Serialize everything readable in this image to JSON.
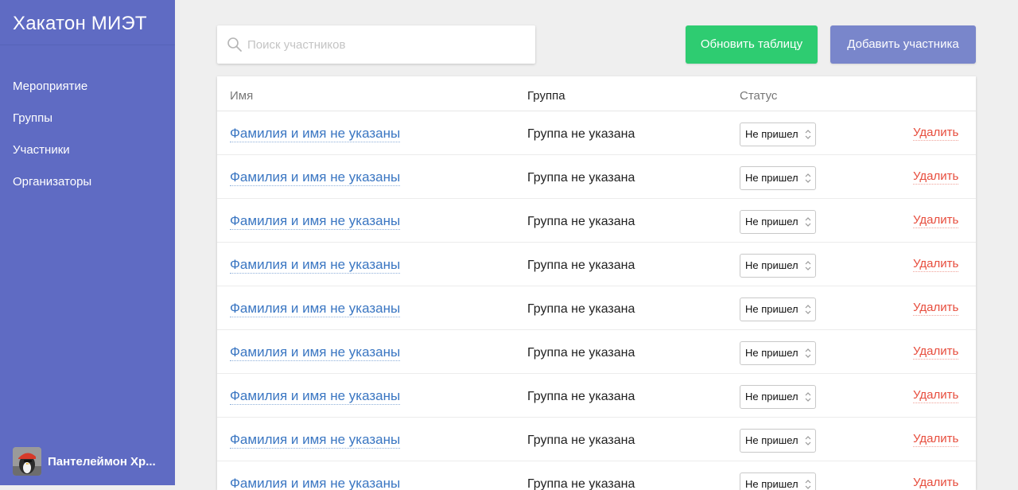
{
  "app": {
    "title": "Хакатон МИЭТ"
  },
  "sidebar": {
    "items": [
      {
        "label": "Мероприятие"
      },
      {
        "label": "Группы"
      },
      {
        "label": "Участники"
      },
      {
        "label": "Организаторы"
      }
    ],
    "user": {
      "name": "Пантелеймон Хр..."
    }
  },
  "search": {
    "placeholder": "Поиск участников",
    "value": ""
  },
  "toolbar": {
    "refresh_label": "Обновить таблицу",
    "add_label": "Добавить участника"
  },
  "colors": {
    "sidebar_bg": "#5f6bc3",
    "refresh_button": "#2ecc71",
    "add_button": "#7986cb",
    "link": "#3a76c2",
    "delete": "#e74c3c"
  },
  "table": {
    "columns": {
      "name": "Имя",
      "group": "Группа",
      "status": "Статус"
    },
    "rows": [
      {
        "name": "Фамилия и имя не указаны",
        "group": "Группа не указана",
        "status": "Не пришел",
        "action": "Удалить"
      },
      {
        "name": "Фамилия и имя не указаны",
        "group": "Группа не указана",
        "status": "Не пришел",
        "action": "Удалить"
      },
      {
        "name": "Фамилия и имя не указаны",
        "group": "Группа не указана",
        "status": "Не пришел",
        "action": "Удалить"
      },
      {
        "name": "Фамилия и имя не указаны",
        "group": "Группа не указана",
        "status": "Не пришел",
        "action": "Удалить"
      },
      {
        "name": "Фамилия и имя не указаны",
        "group": "Группа не указана",
        "status": "Не пришел",
        "action": "Удалить"
      },
      {
        "name": "Фамилия и имя не указаны",
        "group": "Группа не указана",
        "status": "Не пришел",
        "action": "Удалить"
      },
      {
        "name": "Фамилия и имя не указаны",
        "group": "Группа не указана",
        "status": "Не пришел",
        "action": "Удалить"
      },
      {
        "name": "Фамилия и имя не указаны",
        "group": "Группа не указана",
        "status": "Не пришел",
        "action": "Удалить"
      },
      {
        "name": "Фамилия и имя не указаны",
        "group": "Группа не указана",
        "status": "Не пришел",
        "action": "Удалить"
      }
    ]
  }
}
